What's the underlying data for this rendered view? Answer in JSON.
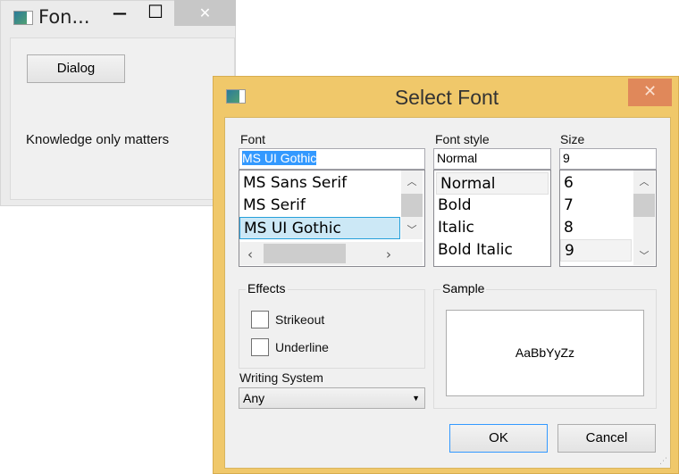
{
  "main_window": {
    "title": "Fon...",
    "minimize": "—",
    "maximize": "☐",
    "close": "✕",
    "dialog_button": "Dialog",
    "text": "Knowledge only matters"
  },
  "dialog": {
    "title": "Select Font",
    "close": "✕",
    "font": {
      "label": "Font",
      "value": "MS UI Gothic",
      "items": [
        "MS Sans Serif",
        "MS Serif",
        "MS UI Gothic"
      ],
      "selected": "MS UI Gothic"
    },
    "style": {
      "label": "Font style",
      "value": "Normal",
      "items": [
        "Normal",
        "Bold",
        "Italic",
        "Bold Italic"
      ]
    },
    "size": {
      "label": "Size",
      "value": "9",
      "items": [
        "6",
        "7",
        "8",
        "9"
      ]
    },
    "effects": {
      "label": "Effects",
      "strikeout": "Strikeout",
      "underline": "Underline"
    },
    "writing_system": {
      "label": "Writing System",
      "value": "Any"
    },
    "sample": {
      "label": "Sample",
      "text": "AaBbYyZz"
    },
    "ok": "OK",
    "cancel": "Cancel"
  },
  "colors": {
    "dialog_frame": "#f0c86a",
    "close_button": "#e0885a",
    "selection": "#cce8f6",
    "text_selection": "#3399ff"
  }
}
